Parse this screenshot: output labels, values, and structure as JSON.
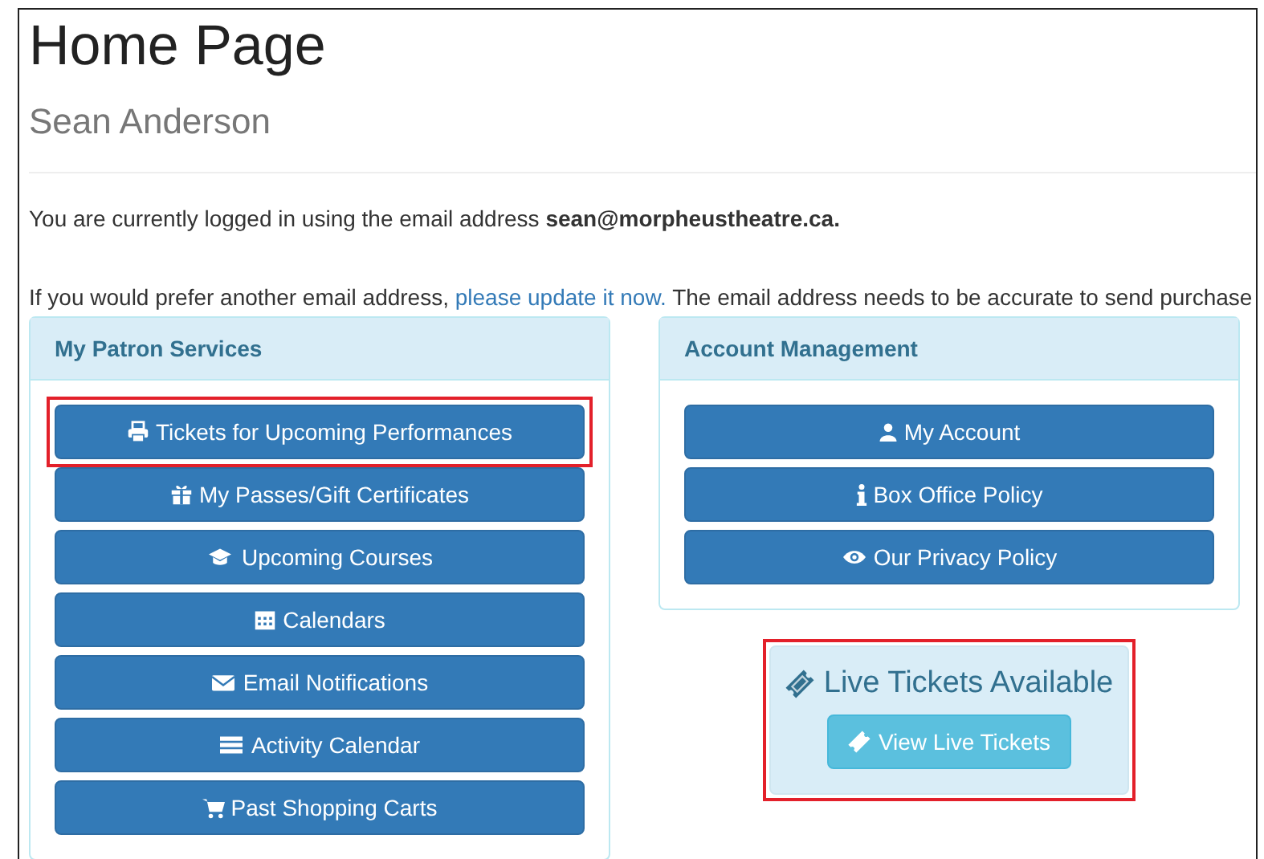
{
  "page": {
    "title": "Home Page",
    "subtitle": "Sean Anderson"
  },
  "login_notice": "You are currently logged in using the email address **sean@morpheustheatre.ca.**",
  "update_notice": {
    "before": "If you would prefer another email address,",
    "link": "please update it now.",
    "after": "The email address needs to be accurate to send purchase"
  },
  "panels": [
    {
      "title": "My Patron Services",
      "buttons": [
        {
          "label": "Tickets for Upcoming Performances",
          "highlighted": true
        },
        {
          "label": "My Passes/Gift Certificates",
          "highlighted": false
        },
        {
          "label": "Upcoming Courses",
          "highlighted": false
        },
        {
          "label": "Calendars",
          "highlighted": false
        },
        {
          "label": "Email Notifications",
          "highlighted": false
        },
        {
          "label": "Activity Calendar",
          "highlighted": false
        },
        {
          "label": "Past Shopping Carts",
          "highlighted": false
        }
      ]
    },
    {
      "title": "Account Management",
      "buttons": [
        {
          "label": "My Account",
          "highlighted": false
        },
        {
          "label": "Box Office Policy",
          "highlighted": false
        },
        {
          "label": "Our Privacy Policy",
          "highlighted": false
        }
      ]
    }
  ],
  "live_tickets": {
    "heading": "Live Tickets Available",
    "button": "View Live Tickets",
    "highlighted": true
  }
}
